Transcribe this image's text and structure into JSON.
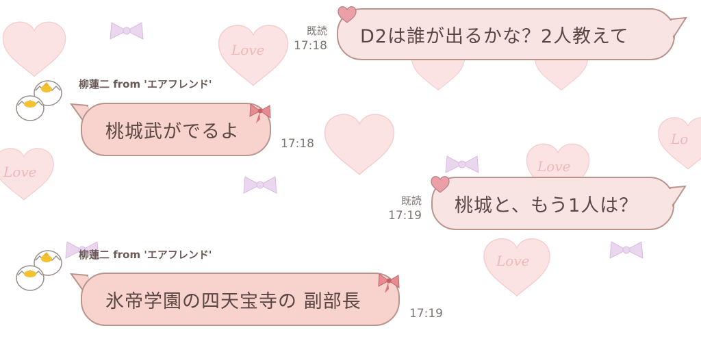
{
  "colors": {
    "bubble_outgoing": "#f8e4e2",
    "bubble_incoming": "#f8d2cc",
    "bubble_border": "#b9948d",
    "text": "#5a4642",
    "meta_text": "#7c7472"
  },
  "messages": [
    {
      "direction": "outgoing",
      "text": "D2は誰が出るかな？2人教えて",
      "read": "既読",
      "time": "17:18",
      "deco": "heart-icon"
    },
    {
      "direction": "incoming",
      "sender": "柳蓮二 from 'エアフレンド'",
      "text": "桃城武がでるよ",
      "time": "17:18",
      "deco": "ribbon-icon",
      "avatar": "chick-egg-avatar"
    },
    {
      "direction": "outgoing",
      "text": "桃城と、もう1人は？",
      "read": "既読",
      "time": "17:19",
      "deco": "heart-icon"
    },
    {
      "direction": "incoming",
      "sender": "柳蓮二 from 'エアフレンド'",
      "text": "氷帝学園の四天宝寺の 副部長",
      "time": "17:19",
      "deco": "ribbon-icon",
      "avatar": "chick-egg-avatar"
    }
  ]
}
